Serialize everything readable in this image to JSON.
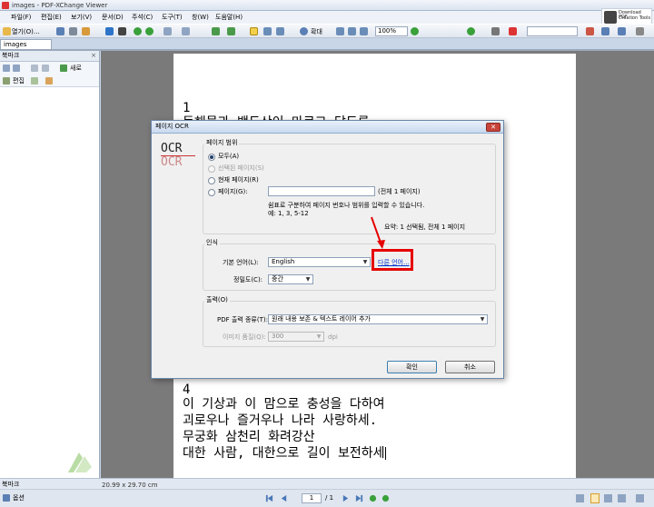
{
  "window": {
    "title": "images - PDF-XChange Viewer"
  },
  "menu": [
    "파일(F)",
    "편집(E)",
    "보기(V)",
    "문서(D)",
    "주석(C)",
    "도구(T)",
    "창(W)",
    "도움말(H)"
  ],
  "brand": {
    "line1": "Download PDF",
    "line2": "Creation Tools"
  },
  "toolbar": {
    "open_label": "열기(O)...",
    "zoom_label": "확대",
    "zoom_value": "100%"
  },
  "tab": {
    "name": "images"
  },
  "bookmarks": {
    "title": "북마크",
    "new_label": "새로",
    "edit_label": "편집",
    "bottom_label": "북마크",
    "options_label": "옵션"
  },
  "page": {
    "num_top": "1",
    "line_top": "동해물과 백두산이 마르고 닳도록",
    "num_bottom": "4",
    "lines_bottom": [
      "이 기상과 이 맘으로 충성을 다하여",
      "괴로우나 즐거우나 나라 사랑하세.",
      "무궁화 삼천리 화려강산",
      "대한 사람, 대한으로 길이 보전하세"
    ]
  },
  "status": {
    "page_size": "20.99 x 29.70 cm",
    "current_page": "1",
    "total_pages": "/ 1"
  },
  "dialog": {
    "title": "페이지 OCR",
    "logo_text": "OCR",
    "range": {
      "group_label": "페이지 범위",
      "opt_all": "모두(A)",
      "opt_selected": "선택된 페이지(S)",
      "opt_current": "현재 페이지(R)",
      "opt_pages": "페이지(G):",
      "pages_value": "",
      "total": "(전체 1 페이지)",
      "hint1": "쉼표로 구분하여 페이지 번호나 범위를 입력할 수 있습니다.",
      "hint2": "예: 1, 3, 5-12",
      "summary": "요약: 1 선택됨, 전체 1 페이지"
    },
    "recog": {
      "group_label": "인식",
      "lang_label": "기본 언어(L):",
      "lang_value": "English",
      "other_lang": "다른 언어...",
      "accuracy_label": "정밀도(C):",
      "accuracy_value": "중간"
    },
    "output": {
      "group_label": "출력(O)",
      "type_label": "PDF 출력 종류(T):",
      "type_value": "원래 내용 보존 & 텍스트 레이어 추가",
      "quality_label": "이미지 품질(Q):",
      "quality_value": "300",
      "quality_unit": "dpi"
    },
    "ok_label": "확인",
    "cancel_label": "취소"
  },
  "colors": {
    "highlight": "#e60000",
    "arrow": "#e60000",
    "link": "#0033cc"
  }
}
